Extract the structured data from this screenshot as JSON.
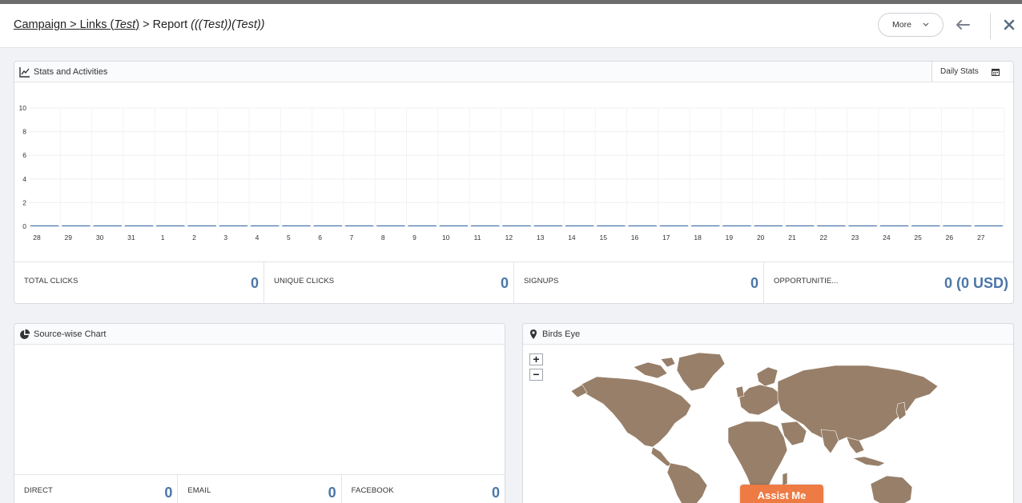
{
  "breadcrumb": {
    "part1": "Campaign",
    "sep1": " > ",
    "part2": "Links (",
    "part2_italic": "Test",
    "part2_end": ")",
    "sep2": " > Report ",
    "part3": "(((Test))(Test))"
  },
  "header": {
    "more_label": "More"
  },
  "stats": {
    "title": "Stats and Activities",
    "daily_label": "Daily Stats"
  },
  "chart_data": {
    "type": "bar",
    "categories": [
      "28",
      "29",
      "30",
      "31",
      "1",
      "2",
      "3",
      "4",
      "5",
      "6",
      "7",
      "8",
      "9",
      "10",
      "11",
      "12",
      "13",
      "14",
      "15",
      "16",
      "17",
      "18",
      "19",
      "20",
      "21",
      "22",
      "23",
      "24",
      "25",
      "26",
      "27"
    ],
    "values": [
      0,
      0,
      0,
      0,
      0,
      0,
      0,
      0,
      0,
      0,
      0,
      0,
      0,
      0,
      0,
      0,
      0,
      0,
      0,
      0,
      0,
      0,
      0,
      0,
      0,
      0,
      0,
      0,
      0,
      0,
      0
    ],
    "yticks": [
      "0",
      "2",
      "4",
      "6",
      "8",
      "10"
    ],
    "ylim": [
      0,
      10
    ],
    "color": "#4a76a8"
  },
  "kpis": [
    {
      "label": "TOTAL CLICKS",
      "value": "0"
    },
    {
      "label": "UNIQUE CLICKS",
      "value": "0"
    },
    {
      "label": "SIGNUPS",
      "value": "0"
    },
    {
      "label": "OPPORTUNITIE...",
      "value": "0 (0 USD)"
    }
  ],
  "source": {
    "title": "Source-wise Chart",
    "kpis": [
      {
        "label": "DIRECT",
        "value": "0"
      },
      {
        "label": "EMAIL",
        "value": "0"
      },
      {
        "label": "FACEBOOK",
        "value": "0"
      }
    ]
  },
  "birds": {
    "title": "Birds Eye",
    "zoom_in": "+",
    "zoom_out": "−"
  },
  "assist": {
    "label": "Assist Me"
  },
  "colors": {
    "accent": "#4a76a8",
    "map_land": "#977f69",
    "assist": "#ee7a44"
  }
}
